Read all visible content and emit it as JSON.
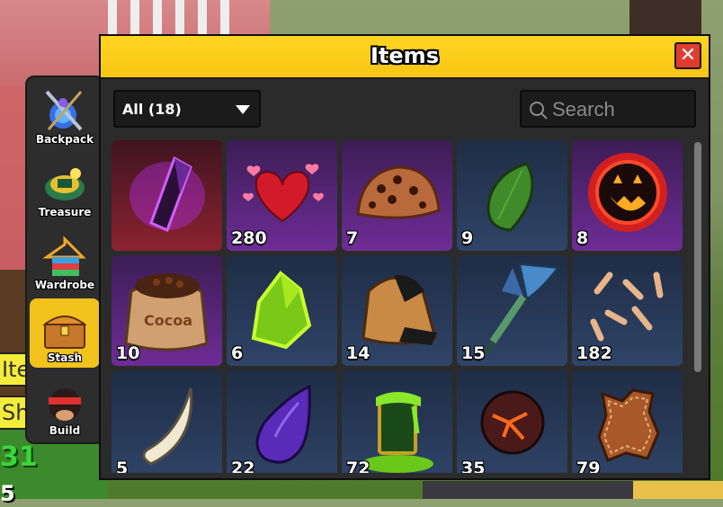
{
  "window": {
    "title": "Items",
    "close_label": "✕"
  },
  "filter": {
    "selected": "All (18)"
  },
  "search": {
    "placeholder": "Search"
  },
  "side_menu": [
    {
      "label": "Backpack",
      "icon": "backpack-icon",
      "active": false
    },
    {
      "label": "Treasure",
      "icon": "treasure-icon",
      "active": false
    },
    {
      "label": "Wardrobe",
      "icon": "wardrobe-icon",
      "active": false
    },
    {
      "label": "Stash",
      "icon": "stash-icon",
      "active": true
    },
    {
      "label": "Build",
      "icon": "build-icon",
      "active": false
    }
  ],
  "items": [
    {
      "icon": "dark-crystal-icon",
      "count": ""
    },
    {
      "icon": "hearts-icon",
      "count": "280"
    },
    {
      "icon": "cookie-rock-icon",
      "count": "7"
    },
    {
      "icon": "green-seed-icon",
      "count": "9"
    },
    {
      "icon": "jack-o-lantern-orb-icon",
      "count": "8"
    },
    {
      "icon": "cocoa-sack-icon",
      "count": "10"
    },
    {
      "icon": "glowing-ore-icon",
      "count": "6"
    },
    {
      "icon": "hooded-cloak-icon",
      "count": "14"
    },
    {
      "icon": "fish-tail-icon",
      "count": "15"
    },
    {
      "icon": "bones-icon",
      "count": "182"
    },
    {
      "icon": "fang-icon",
      "count": "5"
    },
    {
      "icon": "purple-drop-icon",
      "count": "22"
    },
    {
      "icon": "slime-cup-icon",
      "count": "72"
    },
    {
      "icon": "magma-rock-icon",
      "count": "35"
    },
    {
      "icon": "leather-icon",
      "count": "79"
    }
  ],
  "background": {
    "signs": [
      "Item",
      "Sh"
    ],
    "numbers": [
      "31",
      "5"
    ]
  },
  "colors": {
    "title_bar": "#f7c514",
    "close": "#e03c32",
    "active_tab": "#f2c21d",
    "stat_green": "#3ad63a"
  }
}
